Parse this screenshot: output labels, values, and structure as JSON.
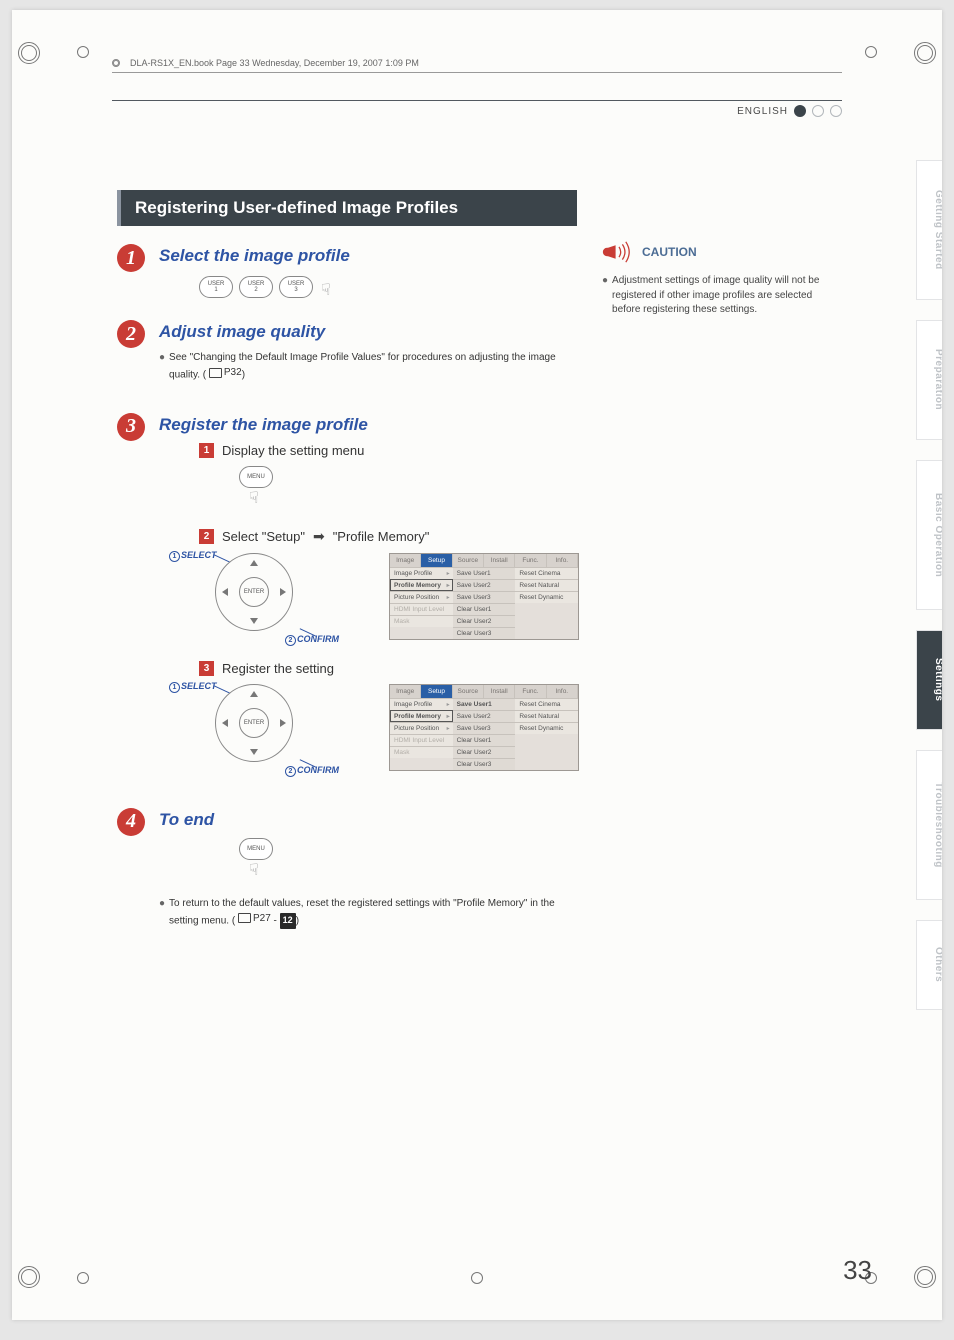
{
  "header": {
    "book_line": "DLA-RS1X_EN.book  Page 33  Wednesday, December 19, 2007  1:09 PM"
  },
  "lang": "ENGLISH",
  "section_title": "Registering User-defined Image Profiles",
  "tabs": {
    "t1": "Getting Started",
    "t2": "Preparation",
    "t3": "Basic Operation",
    "t4": "Settings",
    "t5": "Troubleshooting",
    "t6": "Others"
  },
  "page_number": "33",
  "steps": {
    "s1": {
      "title": "Select the image profile"
    },
    "s2": {
      "title": "Adjust image quality",
      "note_a": "See \"Changing the Default Image Profile Values\" for procedures on adjusting the image quality. (",
      "note_ref": "P32",
      "note_b": ")"
    },
    "s3": {
      "title": "Register the image profile",
      "sub1": "Display the setting menu",
      "sub2_a": "Select \"Setup\"",
      "sub2_b": "\"Profile Memory\"",
      "sub3": "Register the setting"
    },
    "s4": {
      "title": "To end",
      "note_a": "To return to the default values, reset the registered settings with \"Profile Memory\" in the setting menu. (",
      "note_ref1": "P27",
      "dash": " - ",
      "note_ref2": "12",
      "note_b": ")"
    }
  },
  "remote": {
    "user1a": "USER",
    "user1b": "1",
    "user2a": "USER",
    "user2b": "2",
    "user3a": "USER",
    "user3b": "3",
    "menu": "MENU",
    "enter": "ENTER"
  },
  "dpad": {
    "select": "SELECT",
    "confirm": "CONFIRM",
    "n1": "1",
    "n2": "2"
  },
  "menuss": {
    "tabs": {
      "image": "Image",
      "setup": "Setup",
      "source": "Source",
      "install": "Install",
      "func": "Func.",
      "info": "Info."
    },
    "left": {
      "image_profile": "Image Profile",
      "profile_memory": "Profile Memory",
      "picture_position": "Picture Position",
      "hdmi": "HDMI Input Level",
      "mask": "Mask"
    },
    "mid": {
      "su1": "Save User1",
      "su2": "Save User2",
      "su3": "Save User3",
      "cu1": "Clear User1",
      "cu2": "Clear User2",
      "cu3": "Clear User3"
    },
    "right": {
      "rc": "Reset Cinema",
      "rn": "Reset Natural",
      "rd": "Reset Dynamic"
    }
  },
  "caution": {
    "label": "CAUTION",
    "text": "Adjustment settings of image quality will not be registered if other image profiles are selected before registering these settings."
  }
}
